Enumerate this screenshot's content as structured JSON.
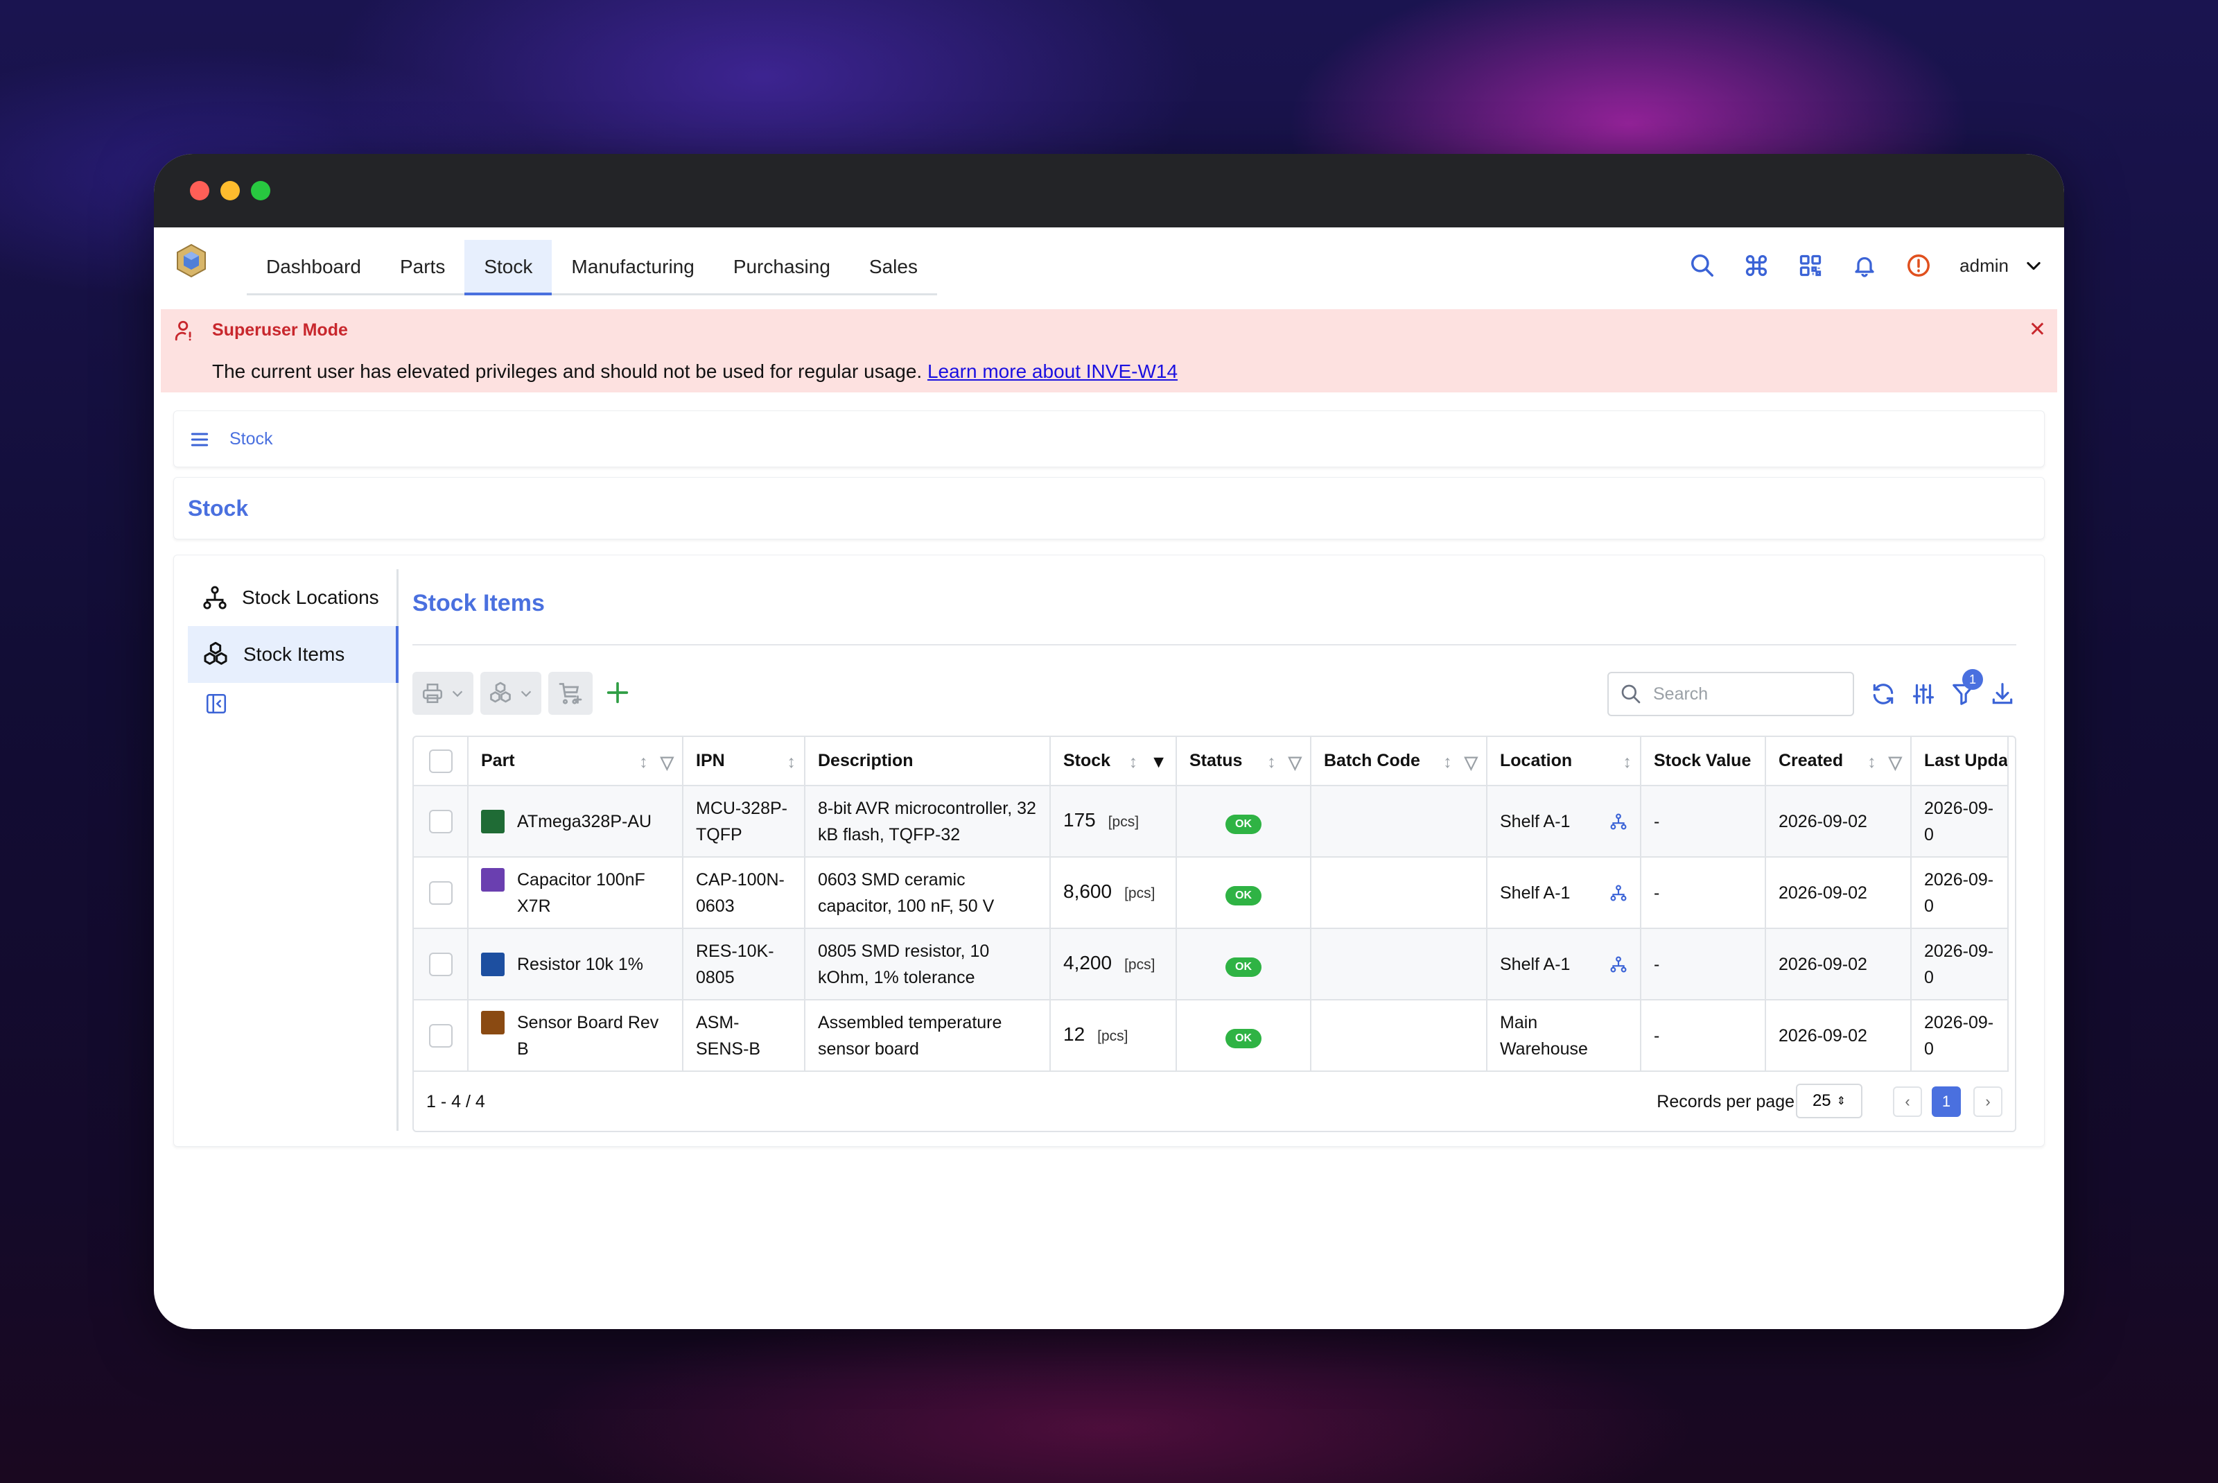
{
  "nav": {
    "tabs": [
      {
        "label": "Dashboard"
      },
      {
        "label": "Parts"
      },
      {
        "label": "Stock"
      },
      {
        "label": "Manufacturing"
      },
      {
        "label": "Purchasing"
      },
      {
        "label": "Sales"
      }
    ],
    "active_tab": "Stock",
    "user": "admin"
  },
  "alert": {
    "title": "Superuser Mode",
    "message": "The current user has elevated privileges and should not be used for regular usage.",
    "link_text": "Learn more about INVE-W14"
  },
  "breadcrumb": "Stock",
  "page_title": "Stock",
  "sidenav": {
    "items": [
      {
        "label": "Stock Locations",
        "icon": "sitemap-icon"
      },
      {
        "label": "Stock Items",
        "icon": "packages-icon"
      }
    ],
    "active": "Stock Items"
  },
  "panel_title": "Stock Items",
  "search": {
    "placeholder": "Search",
    "value": ""
  },
  "filter_count": "1",
  "table": {
    "columns": [
      "Part",
      "IPN",
      "Description",
      "Stock",
      "Status",
      "Batch Code",
      "Location",
      "Stock Value",
      "Created",
      "Last Updat"
    ],
    "rows": [
      {
        "part": "ATmega328P-AU",
        "thumb_color": "#1f6b35",
        "ipn": "MCU-328P-TQFP",
        "description": "8-bit AVR microcontroller, 32 kB flash, TQFP-32",
        "stock": "175",
        "unit": "[pcs]",
        "status": "OK",
        "batch": "",
        "location": "Shelf A-1",
        "value": "-",
        "created": "2026-09-02",
        "updated": "2026-09-0"
      },
      {
        "part": "Capacitor 100nF X7R",
        "thumb_color": "#6a3fb0",
        "ipn": "CAP-100N-0603",
        "description": "0603 SMD ceramic capacitor, 100 nF, 50 V",
        "stock": "8,600",
        "unit": "[pcs]",
        "status": "OK",
        "batch": "",
        "location": "Shelf A-1",
        "value": "-",
        "created": "2026-09-02",
        "updated": "2026-09-0"
      },
      {
        "part": "Resistor 10k 1%",
        "thumb_color": "#1d4fa0",
        "ipn": "RES-10K-0805",
        "description": "0805 SMD resistor, 10 kOhm, 1% tolerance",
        "stock": "4,200",
        "unit": "[pcs]",
        "status": "OK",
        "batch": "",
        "location": "Shelf A-1",
        "value": "-",
        "created": "2026-09-02",
        "updated": "2026-09-0"
      },
      {
        "part": "Sensor Board Rev B",
        "thumb_color": "#8a4a12",
        "ipn": "ASM-SENS-B",
        "description": "Assembled temperature sensor board",
        "stock": "12",
        "unit": "[pcs]",
        "status": "OK",
        "batch": "",
        "location": "Main Warehouse",
        "value": "-",
        "created": "2026-09-02",
        "updated": "2026-09-0"
      }
    ]
  },
  "pagination": {
    "summary": "1 - 4 / 4",
    "records_label": "Records per page",
    "records_per_page": "25",
    "current_page": "1"
  },
  "colors": {
    "accent": "#4a70df",
    "ok": "#2fb344",
    "alert_bg": "#fde1e0",
    "alert_text": "#c8272d"
  }
}
